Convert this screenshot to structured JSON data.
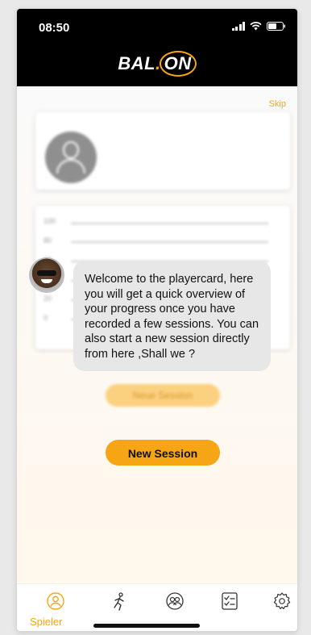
{
  "status_bar": {
    "time": "08:50"
  },
  "header": {
    "logo_prefix": "BAL",
    "logo_dot": ".",
    "logo_suffix": "ON"
  },
  "onboarding": {
    "skip_label": "Skip",
    "chart_ticks": [
      "100",
      "80",
      "60",
      "40",
      "20",
      "0"
    ],
    "bubble_text": "Welcome to the playercard, here you will get a quick overview of your progress once you have recorded a few sessions. You can also start a new session directly from here ,Shall we ?",
    "blurred_button_label": "Neue Session",
    "primary_button_label": "New Session"
  },
  "tabbar": {
    "active_label": "Spieler",
    "items": [
      "player-icon",
      "running-icon",
      "team-icon",
      "checklist-icon",
      "gear-icon"
    ]
  },
  "colors": {
    "accent": "#f6a515",
    "header_bg": "#000000",
    "bubble_bg": "#e7e7e7"
  }
}
